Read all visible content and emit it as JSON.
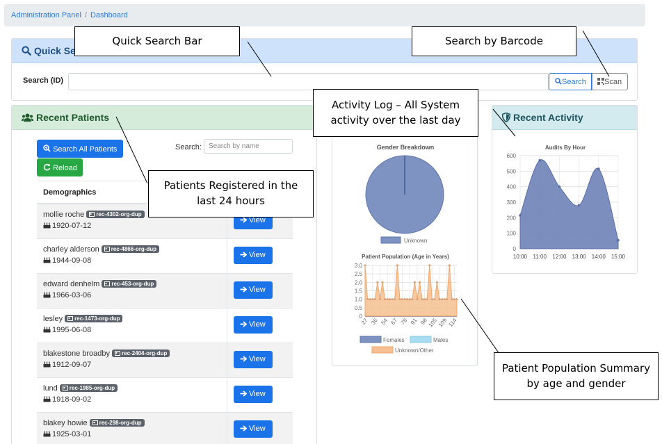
{
  "breadcrumb": {
    "items": [
      "Administration Panel",
      "Dashboard"
    ],
    "separator": "/"
  },
  "quick_search": {
    "title": "Quick Search",
    "search_label": "Search (ID)",
    "input_value": "",
    "search_button": "Search",
    "scan_button": "Scan"
  },
  "recent_patients": {
    "title": "Recent Patients",
    "search_all_button": "Search All Patients",
    "reload_button": "Reload",
    "search_label": "Search:",
    "search_placeholder": "Search by name",
    "column_header": "Demographics",
    "view_label": "View",
    "rows": [
      {
        "name": "mollie roche",
        "id": "rec-4302-org-dup",
        "dob": "1920-07-12"
      },
      {
        "name": "charley alderson",
        "id": "rec-4866-org-dup",
        "dob": "1944-09-08"
      },
      {
        "name": "edward denhelm",
        "id": "rec-453-org-dup",
        "dob": "1966-03-06"
      },
      {
        "name": "lesley",
        "id": "rec-1473-org-dup",
        "dob": "1995-06-08"
      },
      {
        "name": "blakestone broadby",
        "id": "rec-2404-org-dup",
        "dob": "1912-09-07"
      },
      {
        "name": "lund",
        "id": "rec-1985-org-dup",
        "dob": "1918-09-02"
      },
      {
        "name": "blakey howie",
        "id": "rec-298-org-dup",
        "dob": "1925-03-01"
      }
    ]
  },
  "recent_activity": {
    "title": "Recent Activity"
  },
  "chart_data": [
    {
      "type": "pie",
      "title": "Gender Breakdown",
      "categories": [
        "Unknown"
      ],
      "values": [
        100
      ],
      "legend": "bottom",
      "colors": [
        "#7f93c2"
      ]
    },
    {
      "type": "area",
      "title": "Patient Population (Age in Years)",
      "x_tick_labels": [
        "27",
        "36",
        "54",
        "67",
        "78",
        "91",
        "98",
        "105",
        "109",
        "114"
      ],
      "ylim": [
        0,
        3.0
      ],
      "y_ticks": [
        "0",
        "0.5",
        "1.0",
        "1.5",
        "2.0",
        "2.5",
        "3.0"
      ],
      "legend": "bottom",
      "series": [
        {
          "name": "Females",
          "color": "#7f93c2",
          "values": []
        },
        {
          "name": "Males",
          "color": "#a8dcf0",
          "values": []
        },
        {
          "name": "Unknown/Other",
          "color": "#f6bf91",
          "values": [
            3,
            1,
            1,
            1,
            1,
            2,
            1,
            2,
            1,
            1,
            1,
            1,
            1,
            3,
            1,
            1,
            1,
            1,
            1,
            1,
            2,
            1,
            2,
            1,
            1,
            1,
            3,
            1,
            1,
            2,
            1,
            1,
            1,
            1,
            3,
            1,
            1,
            1
          ]
        }
      ],
      "grid": true
    },
    {
      "type": "area",
      "title": "Audits By Hour",
      "x": [
        "10:00",
        "11:00",
        "12:00",
        "13:00",
        "14:00",
        "15:00"
      ],
      "values": [
        215,
        570,
        400,
        280,
        515,
        55
      ],
      "ylim": [
        0,
        600
      ],
      "y_ticks": [
        "0",
        "100",
        "200",
        "300",
        "400",
        "500",
        "600"
      ],
      "grid": true,
      "colors": [
        "#6d82b7"
      ]
    }
  ],
  "callouts": {
    "quick_search_bar": "Quick Search Bar",
    "search_by_barcode": "Search by Barcode",
    "activity_log": "Activity Log – All System activity over the last day",
    "patients_registered": "Patients Registered in the last 24 hours",
    "population_summary": "Patient Population Summary by age and gender"
  }
}
